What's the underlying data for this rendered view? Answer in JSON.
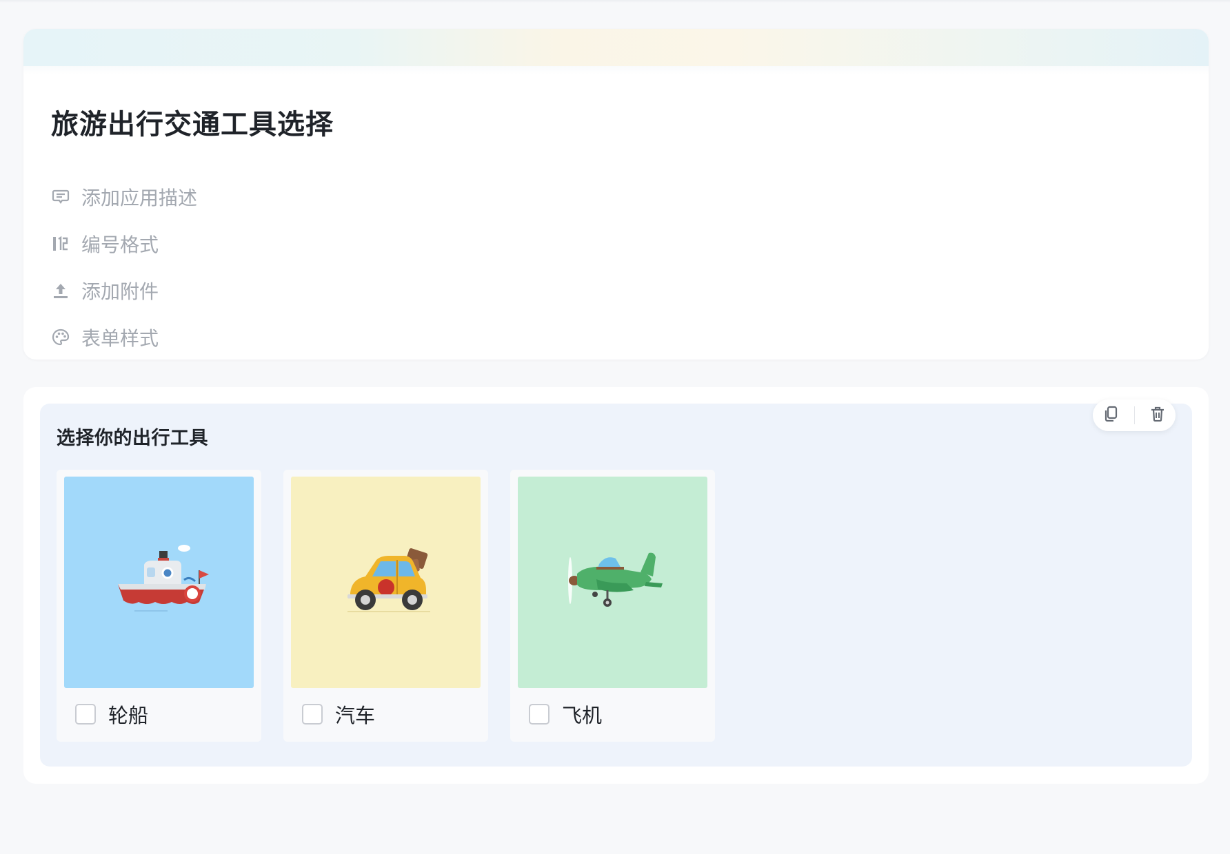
{
  "form": {
    "title": "旅游出行交通工具选择"
  },
  "meta_actions": [
    {
      "label": "添加应用描述",
      "icon": "comment-icon"
    },
    {
      "label": "编号格式",
      "icon": "numbering-icon"
    },
    {
      "label": "添加附件",
      "icon": "upload-icon"
    },
    {
      "label": "表单样式",
      "icon": "palette-icon"
    }
  ],
  "question": {
    "title": "选择你的出行工具",
    "toolbar": {
      "copy_icon": "copy-icon",
      "delete_icon": "trash-icon"
    },
    "options": [
      {
        "label": "轮船",
        "image": "ship-illustration",
        "bg": "#a2d9fa",
        "checked": false
      },
      {
        "label": "汽车",
        "image": "car-illustration",
        "bg": "#f8f0c0",
        "checked": false
      },
      {
        "label": "飞机",
        "image": "airplane-illustration",
        "bg": "#c4edd4",
        "checked": false
      }
    ]
  },
  "colors": {
    "page_bg": "#f7f8fa",
    "card_bg": "#ffffff",
    "question_bg": "#eef3fb",
    "muted_text": "#a3a8b0"
  }
}
